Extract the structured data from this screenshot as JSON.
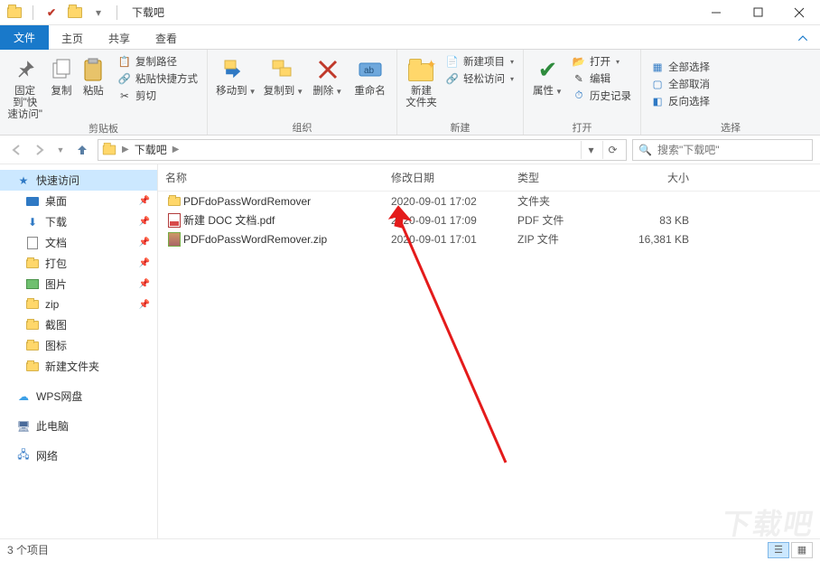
{
  "window": {
    "title": "下载吧"
  },
  "tabs": {
    "file": "文件",
    "home": "主页",
    "share": "共享",
    "view": "查看"
  },
  "ribbon": {
    "pin": "固定到\"快\n速访问\"",
    "copy": "复制",
    "paste": "粘贴",
    "copy_path": "复制路径",
    "paste_shortcut": "粘贴快捷方式",
    "cut": "剪切",
    "clipboard_group": "剪贴板",
    "move_to": "移动到",
    "copy_to": "复制到",
    "delete": "删除",
    "rename": "重命名",
    "organize_group": "组织",
    "new_folder": "新建\n文件夹",
    "new_item": "新建项目",
    "easy_access": "轻松访问",
    "new_group": "新建",
    "properties": "属性",
    "open": "打开",
    "edit": "编辑",
    "history": "历史记录",
    "open_group": "打开",
    "select_all": "全部选择",
    "select_none": "全部取消",
    "invert": "反向选择",
    "select_group": "选择"
  },
  "address": {
    "root": "下载吧",
    "refresh_hint": "⟳"
  },
  "search": {
    "placeholder": "搜索\"下载吧\""
  },
  "sidebar": {
    "quick": "快速访问",
    "items": [
      {
        "label": "桌面"
      },
      {
        "label": "下载"
      },
      {
        "label": "文档"
      },
      {
        "label": "打包"
      },
      {
        "label": "图片"
      },
      {
        "label": "zip"
      },
      {
        "label": "截图"
      },
      {
        "label": "图标"
      },
      {
        "label": "新建文件夹"
      }
    ],
    "wps": "WPS网盘",
    "thispc": "此电脑",
    "network": "网络"
  },
  "columns": {
    "name": "名称",
    "date": "修改日期",
    "type": "类型",
    "size": "大小"
  },
  "files": [
    {
      "name": "PDFdoPassWordRemover",
      "date": "2020-09-01 17:02",
      "type": "文件夹",
      "size": ""
    },
    {
      "name": "新建 DOC 文档.pdf",
      "date": "2020-09-01 17:09",
      "type": "PDF 文件",
      "size": "83 KB"
    },
    {
      "name": "PDFdoPassWordRemover.zip",
      "date": "2020-09-01 17:01",
      "type": "ZIP 文件",
      "size": "16,381 KB"
    }
  ],
  "status": {
    "count": "3 个项目"
  },
  "watermark": "下载吧"
}
